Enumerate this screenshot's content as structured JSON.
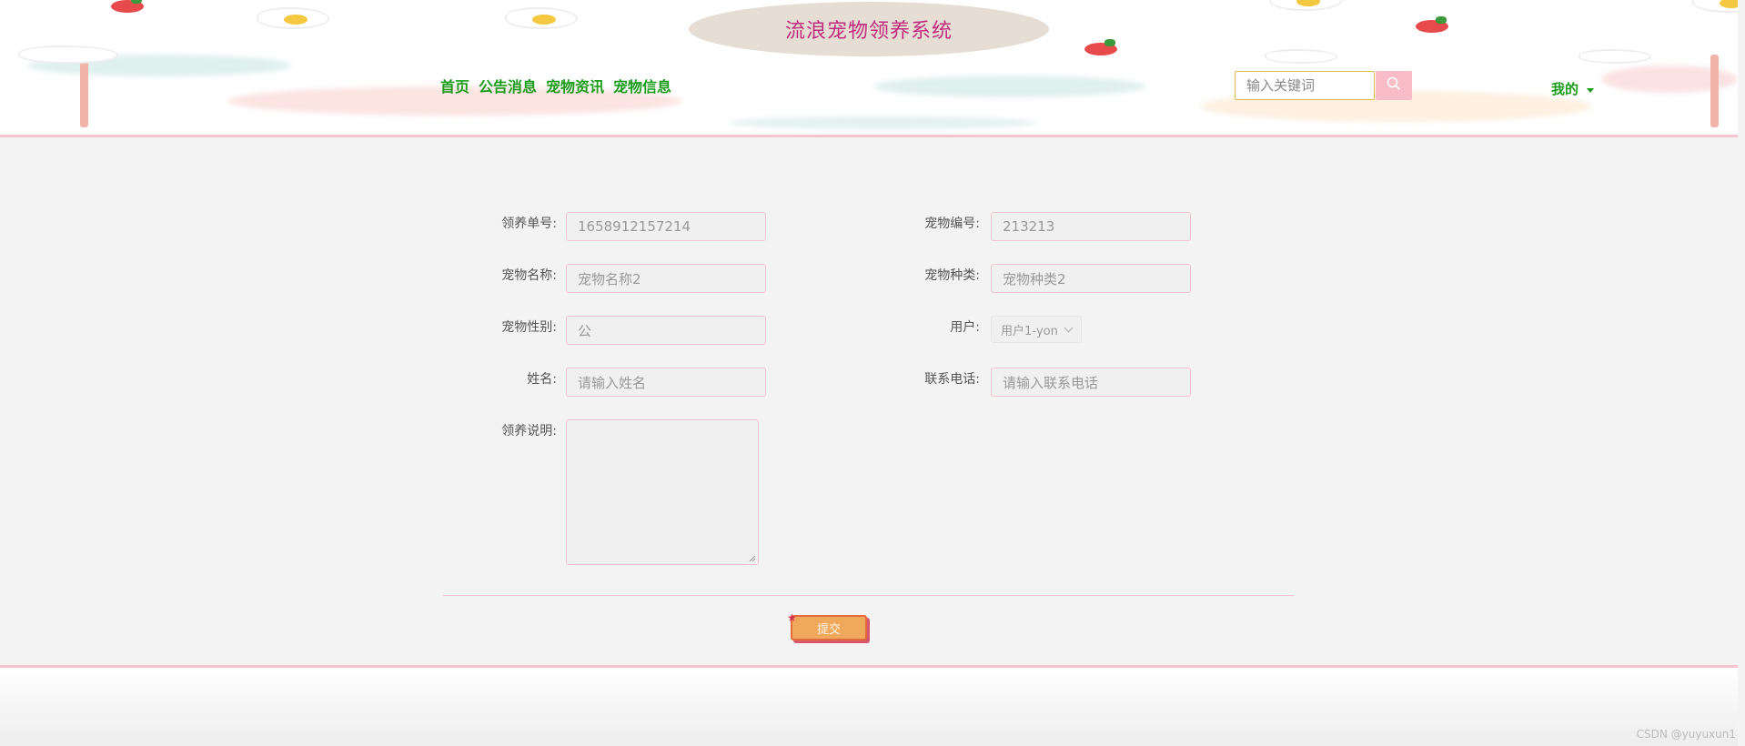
{
  "header": {
    "site_title": "流浪宠物领养系统",
    "nav": [
      {
        "label": "首页"
      },
      {
        "label": "公告消息"
      },
      {
        "label": "宠物资讯"
      },
      {
        "label": "宠物信息"
      }
    ],
    "search_placeholder": "输入关键词",
    "mine_label": "我的"
  },
  "form": {
    "order_no": {
      "label": "领养单号:",
      "value": "1658912157214"
    },
    "pet_no": {
      "label": "宠物编号:",
      "value": "213213"
    },
    "pet_name": {
      "label": "宠物名称:",
      "value": "宠物名称2"
    },
    "pet_type": {
      "label": "宠物种类:",
      "value": "宠物种类2"
    },
    "pet_gender": {
      "label": "宠物性别:",
      "value": "公"
    },
    "user": {
      "label": "用户:",
      "value": "用户1-yon"
    },
    "name": {
      "label": "姓名:",
      "placeholder": "请输入姓名"
    },
    "phone": {
      "label": "联系电话:",
      "placeholder": "请输入联系电话"
    },
    "note": {
      "label": "领养说明:"
    },
    "submit_label": "提交"
  },
  "watermark": "CSDN @yuyuxun1",
  "colors": {
    "title": "#c02c7c",
    "nav": "#1a9c1a",
    "accent_pink": "#f7bcc6",
    "submit": "#f0a85c"
  }
}
